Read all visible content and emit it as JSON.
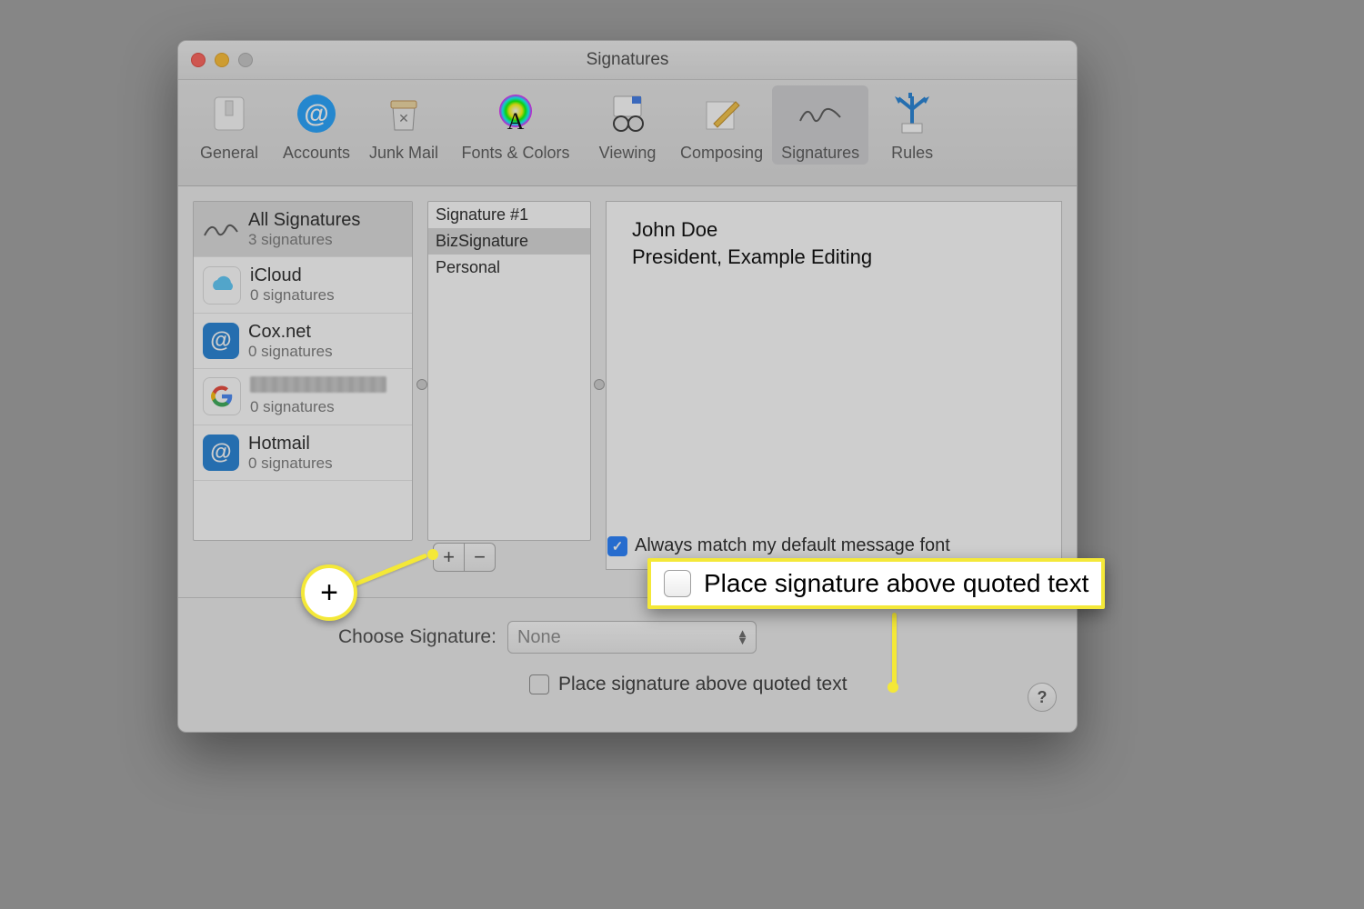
{
  "window": {
    "title": "Signatures"
  },
  "toolbar": {
    "items": [
      {
        "label": "General"
      },
      {
        "label": "Accounts"
      },
      {
        "label": "Junk Mail"
      },
      {
        "label": "Fonts & Colors"
      },
      {
        "label": "Viewing"
      },
      {
        "label": "Composing"
      },
      {
        "label": "Signatures"
      },
      {
        "label": "Rules"
      }
    ],
    "selected": 6
  },
  "accounts": [
    {
      "name": "All Signatures",
      "sub": "3 signatures",
      "icon": "signature"
    },
    {
      "name": "iCloud",
      "sub": "0 signatures",
      "icon": "icloud"
    },
    {
      "name": "Cox.net",
      "sub": "0 signatures",
      "icon": "at"
    },
    {
      "name": "__redacted__",
      "sub": "0 signatures",
      "icon": "google"
    },
    {
      "name": "Hotmail",
      "sub": "0 signatures",
      "icon": "at"
    }
  ],
  "accounts_selected": 0,
  "siglist": [
    "Signature #1",
    "BizSignature",
    "Personal"
  ],
  "siglist_selected": 1,
  "preview": {
    "line1": "John Doe",
    "line2": "President, Example Editing"
  },
  "always_match_label": "Always match my default message font",
  "always_match_checked": true,
  "choose_label": "Choose Signature:",
  "choose_value": "None",
  "place_label": "Place signature above quoted text",
  "place_checked": false,
  "buttons": {
    "add": "+",
    "remove": "−",
    "help": "?"
  },
  "callout": {
    "place_big": "Place signature above quoted text",
    "plus": "+"
  }
}
